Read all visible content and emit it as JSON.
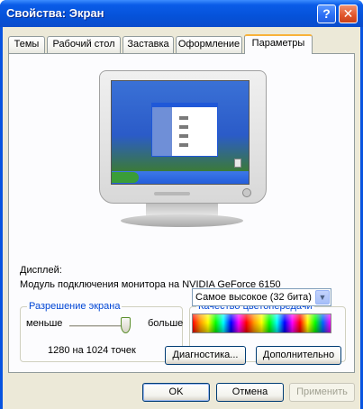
{
  "window": {
    "title": "Свойства: Экран",
    "help_glyph": "?",
    "close_glyph": "✕"
  },
  "tabs": [
    {
      "label": "Темы",
      "active": false
    },
    {
      "label": "Рабочий стол",
      "active": false
    },
    {
      "label": "Заставка",
      "active": false
    },
    {
      "label": "Оформление",
      "active": false
    },
    {
      "label": "Параметры",
      "active": true
    }
  ],
  "display": {
    "label": "Дисплей:",
    "value": "Модуль подключения монитора на NVIDIA GeForce 6150"
  },
  "resolution": {
    "legend": "Разрешение экрана",
    "less_label": "меньше",
    "more_label": "больше",
    "value_text": "1280 на 1024 точек",
    "slider_level": 1.0
  },
  "color_quality": {
    "legend": "Качество цветопередачи",
    "selected": "Самое высокое (32 бита)",
    "arrow_glyph": "▼"
  },
  "buttons": {
    "troubleshoot": "Диагностика...",
    "advanced": "Дополнительно",
    "ok": "OK",
    "cancel": "Отмена",
    "apply": "Применить"
  },
  "colors": {
    "title_bar": "#0552d9",
    "dialog_bg": "#ece9d8",
    "legend_text": "#0046d5",
    "active_tab_accent": "#f8b23a"
  }
}
